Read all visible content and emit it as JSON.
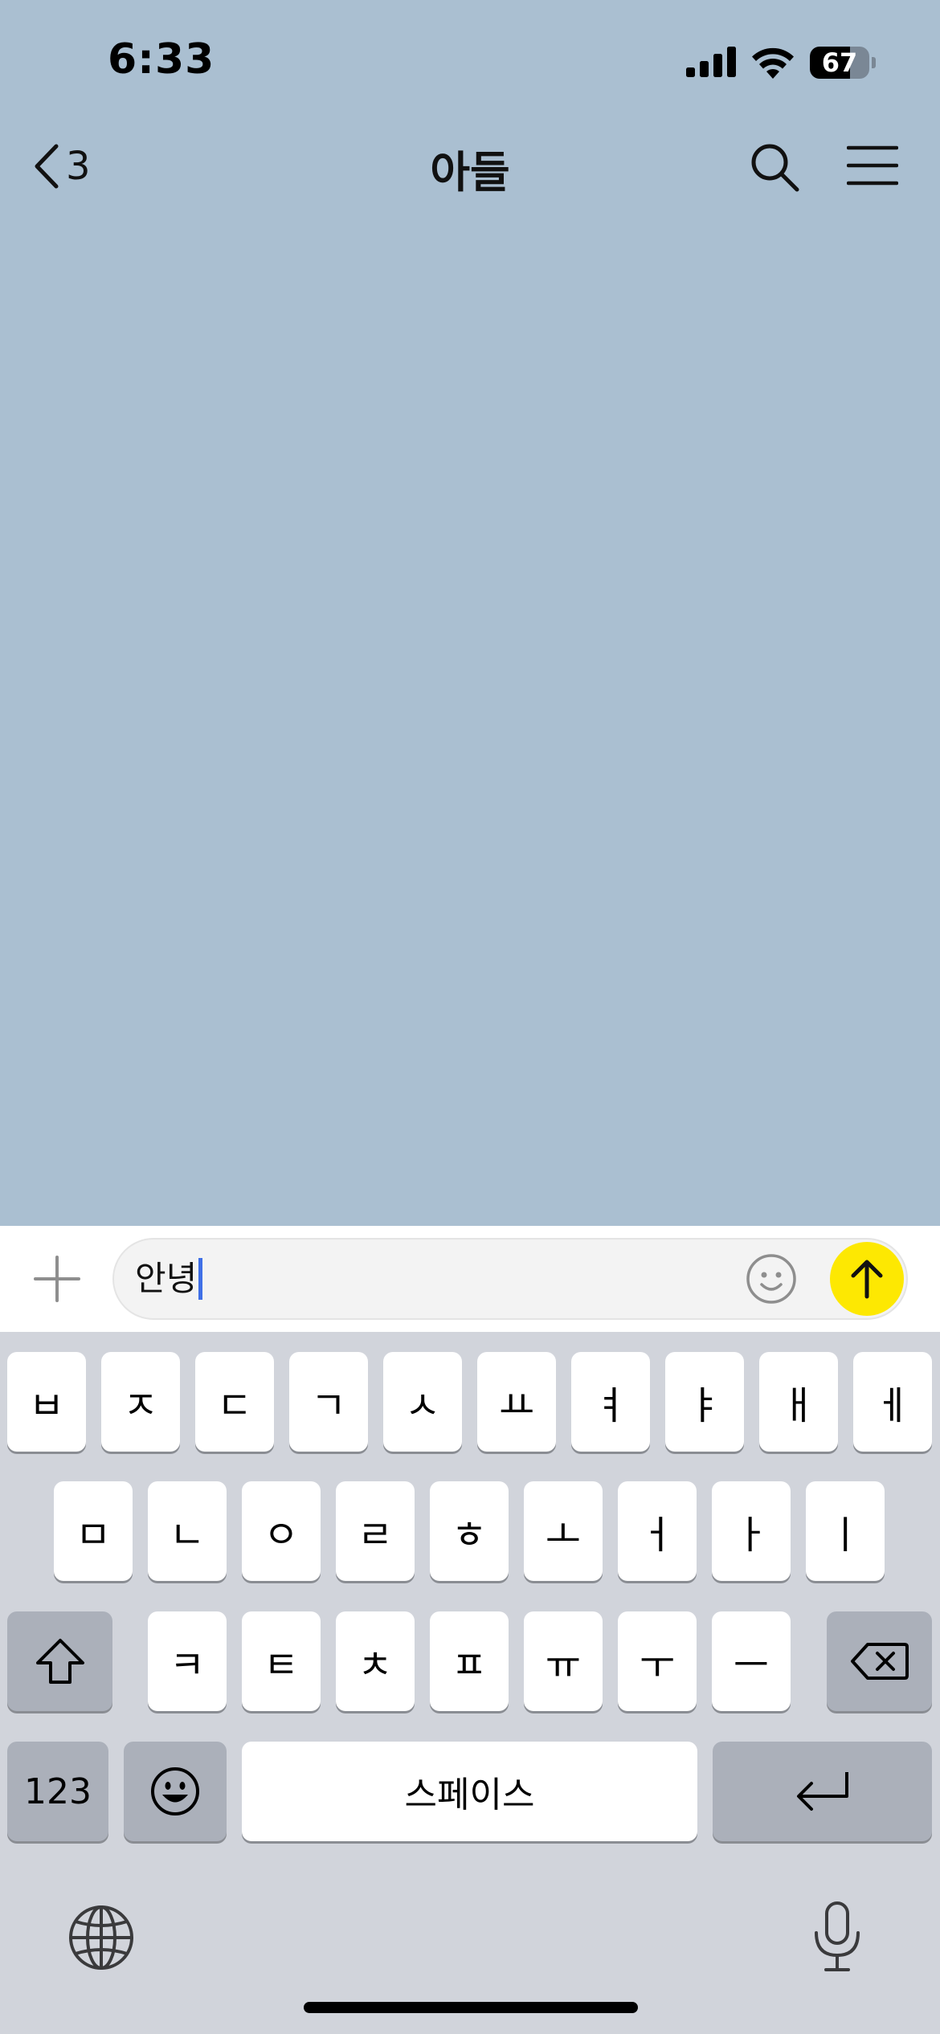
{
  "status_bar": {
    "time": "6:33",
    "battery_level": "67",
    "battery_fraction": 0.67
  },
  "header": {
    "back_count": "3",
    "title": "아들"
  },
  "composer": {
    "input_value": "안녕"
  },
  "keyboard": {
    "row1": [
      "ㅂ",
      "ㅈ",
      "ㄷ",
      "ㄱ",
      "ㅅ",
      "ㅛ",
      "ㅕ",
      "ㅑ",
      "ㅐ",
      "ㅔ"
    ],
    "row2": [
      "ㅁ",
      "ㄴ",
      "ㅇ",
      "ㄹ",
      "ㅎ",
      "ㅗ",
      "ㅓ",
      "ㅏ",
      "ㅣ"
    ],
    "row3": [
      "ㅋ",
      "ㅌ",
      "ㅊ",
      "ㅍ",
      "ㅠ",
      "ㅜ",
      "ㅡ"
    ],
    "numbers_label": "123",
    "space_label": "스페이스"
  },
  "colors": {
    "chat_background": "#aabfd1",
    "send_button": "#fde802",
    "caret": "#3f6fe6",
    "keyboard_background": "#d1d4db"
  },
  "icons": [
    "chevron-left-icon",
    "search-icon",
    "menu-icon",
    "plus-icon",
    "smiley-icon",
    "arrow-up-icon",
    "shift-icon",
    "backspace-icon",
    "emoji-icon",
    "return-icon",
    "globe-icon",
    "microphone-icon"
  ]
}
